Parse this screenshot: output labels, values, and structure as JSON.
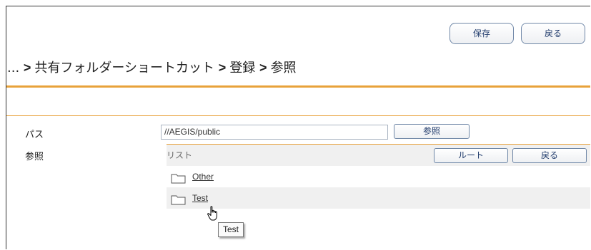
{
  "toolbar": {
    "save_label": "保存",
    "back_label": "戻る"
  },
  "breadcrumb": {
    "ellipsis": "...",
    "separator": ">",
    "items": [
      "共有フォルダーショートカット",
      "登録",
      "参照"
    ]
  },
  "form": {
    "path_label": "パス",
    "path_value": "//AEGIS/public",
    "browse_button_label": "参照",
    "browse_label": "参照"
  },
  "browser": {
    "list_label": "リスト",
    "root_button_label": "ルート",
    "back_button_label": "戻る",
    "folders": [
      {
        "name": "Other",
        "icon": "folder-icon"
      },
      {
        "name": "Test",
        "icon": "folder-icon"
      }
    ]
  },
  "tooltip": {
    "text": "Test"
  },
  "colors": {
    "accent_orange": "#e8a23a",
    "button_border": "#6f87a7",
    "band_gray": "#f0f0f0"
  },
  "cursor_icon": "hand-pointer-icon"
}
